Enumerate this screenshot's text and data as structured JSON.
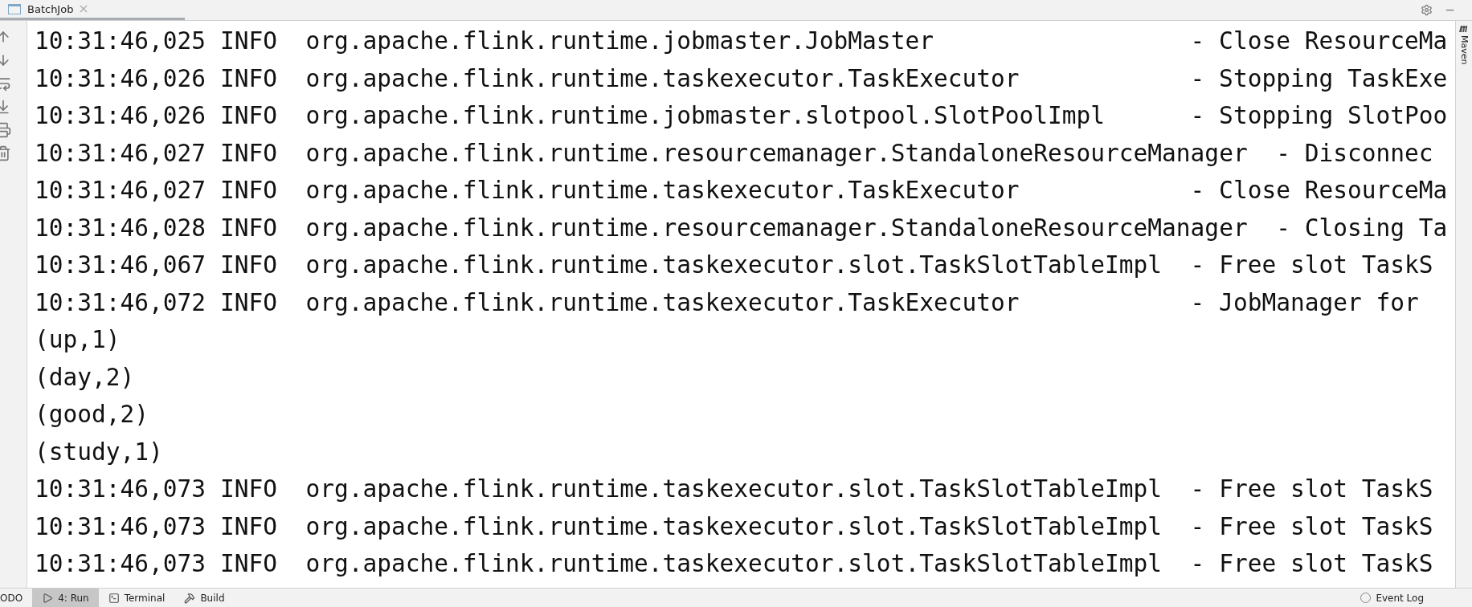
{
  "editor_tab": {
    "title": "BatchJob"
  },
  "console_lines": [
    {
      "kind": "log",
      "time": "10:31:46,025",
      "level": "INFO",
      "logger": "org.apache.flink.runtime.jobmaster.JobMaster",
      "message": "- Close ResourceMa"
    },
    {
      "kind": "log",
      "time": "10:31:46,026",
      "level": "INFO",
      "logger": "org.apache.flink.runtime.taskexecutor.TaskExecutor",
      "message": "- Stopping TaskExe"
    },
    {
      "kind": "log",
      "time": "10:31:46,026",
      "level": "INFO",
      "logger": "org.apache.flink.runtime.jobmaster.slotpool.SlotPoolImpl",
      "message": "- Stopping SlotPoo"
    },
    {
      "kind": "log",
      "time": "10:31:46,027",
      "level": "INFO",
      "logger": "org.apache.flink.runtime.resourcemanager.StandaloneResourceManager",
      "message": "- Disconnec"
    },
    {
      "kind": "log",
      "time": "10:31:46,027",
      "level": "INFO",
      "logger": "org.apache.flink.runtime.taskexecutor.TaskExecutor",
      "message": "- Close ResourceMa"
    },
    {
      "kind": "log",
      "time": "10:31:46,028",
      "level": "INFO",
      "logger": "org.apache.flink.runtime.resourcemanager.StandaloneResourceManager",
      "message": "- Closing Ta"
    },
    {
      "kind": "log",
      "time": "10:31:46,067",
      "level": "INFO",
      "logger": "org.apache.flink.runtime.taskexecutor.slot.TaskSlotTableImpl",
      "message": "- Free slot TaskS"
    },
    {
      "kind": "log",
      "time": "10:31:46,072",
      "level": "INFO",
      "logger": "org.apache.flink.runtime.taskexecutor.TaskExecutor",
      "message": "- JobManager for"
    },
    {
      "kind": "output",
      "text": "(up,1)"
    },
    {
      "kind": "output",
      "text": "(day,2)"
    },
    {
      "kind": "output",
      "text": "(good,2)"
    },
    {
      "kind": "output",
      "text": "(study,1)"
    },
    {
      "kind": "log",
      "time": "10:31:46,073",
      "level": "INFO",
      "logger": "org.apache.flink.runtime.taskexecutor.slot.TaskSlotTableImpl",
      "message": "- Free slot TaskS"
    },
    {
      "kind": "log",
      "time": "10:31:46,073",
      "level": "INFO",
      "logger": "org.apache.flink.runtime.taskexecutor.slot.TaskSlotTableImpl",
      "message": "- Free slot TaskS"
    },
    {
      "kind": "log",
      "time": "10:31:46,073",
      "level": "INFO",
      "logger": "org.apache.flink.runtime.taskexecutor.slot.TaskSlotTableImpl",
      "message": "- Free slot TaskS"
    }
  ],
  "right_sidebar": {
    "label": "Maven"
  },
  "bottom_tabs": [
    {
      "kind": "todo",
      "label": "ODO",
      "selected": false
    },
    {
      "kind": "run",
      "label": "4: Run",
      "selected": true
    },
    {
      "kind": "terminal",
      "label": "Terminal",
      "selected": false
    },
    {
      "kind": "build",
      "label": "Build",
      "selected": false
    }
  ],
  "event_log": {
    "label": "Event Log"
  }
}
